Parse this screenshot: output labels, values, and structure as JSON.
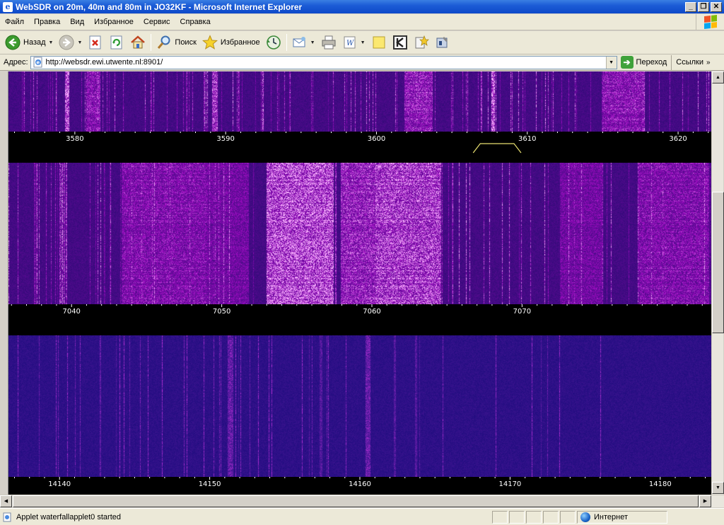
{
  "window": {
    "title": "WebSDR on 20m, 40m and 80m in JO32KF - Microsoft Internet Explorer",
    "controls": [
      "_",
      "❐",
      "✕"
    ]
  },
  "menu": {
    "items": [
      "Файл",
      "Правка",
      "Вид",
      "Избранное",
      "Сервис",
      "Справка"
    ]
  },
  "toolbar": {
    "back_label": "Назад",
    "search_label": "Поиск",
    "favorites_label": "Избранное"
  },
  "address": {
    "label": "Адрес:",
    "url": "http://websdr.ewi.utwente.nl:8901/",
    "go_label": "Переход",
    "links_label": "Ссылки"
  },
  "bands": [
    {
      "id": "80m",
      "ticks": [
        "3580",
        "3590",
        "3600",
        "3610",
        "3620"
      ],
      "tick_values": [
        3580,
        3590,
        3600,
        3610,
        3620
      ],
      "range": [
        3575.6,
        3622.2
      ],
      "palette": "violet",
      "passband": [
        3606.6,
        3609.4
      ]
    },
    {
      "id": "40m",
      "ticks": [
        "7040",
        "7050",
        "7060",
        "7070"
      ],
      "tick_values": [
        7040,
        7050,
        7060,
        7070
      ],
      "range": [
        7035.8,
        7082.6
      ],
      "palette": "violet"
    },
    {
      "id": "20m",
      "ticks": [
        "14140",
        "14150",
        "14160",
        "14170",
        "14180"
      ],
      "tick_values": [
        14140,
        14150,
        14160,
        14170,
        14180
      ],
      "range": [
        14136.6,
        14183.4
      ],
      "palette": "blue"
    }
  ],
  "status": {
    "text": "Applet waterfallapplet0 started",
    "zone": "Интернет"
  },
  "colors": {
    "titlebar": "#0d49c9",
    "chrome": "#ece9d8",
    "scale_bg": "#000000",
    "scale_text": "#ffffff",
    "passband": "#e8e070"
  }
}
